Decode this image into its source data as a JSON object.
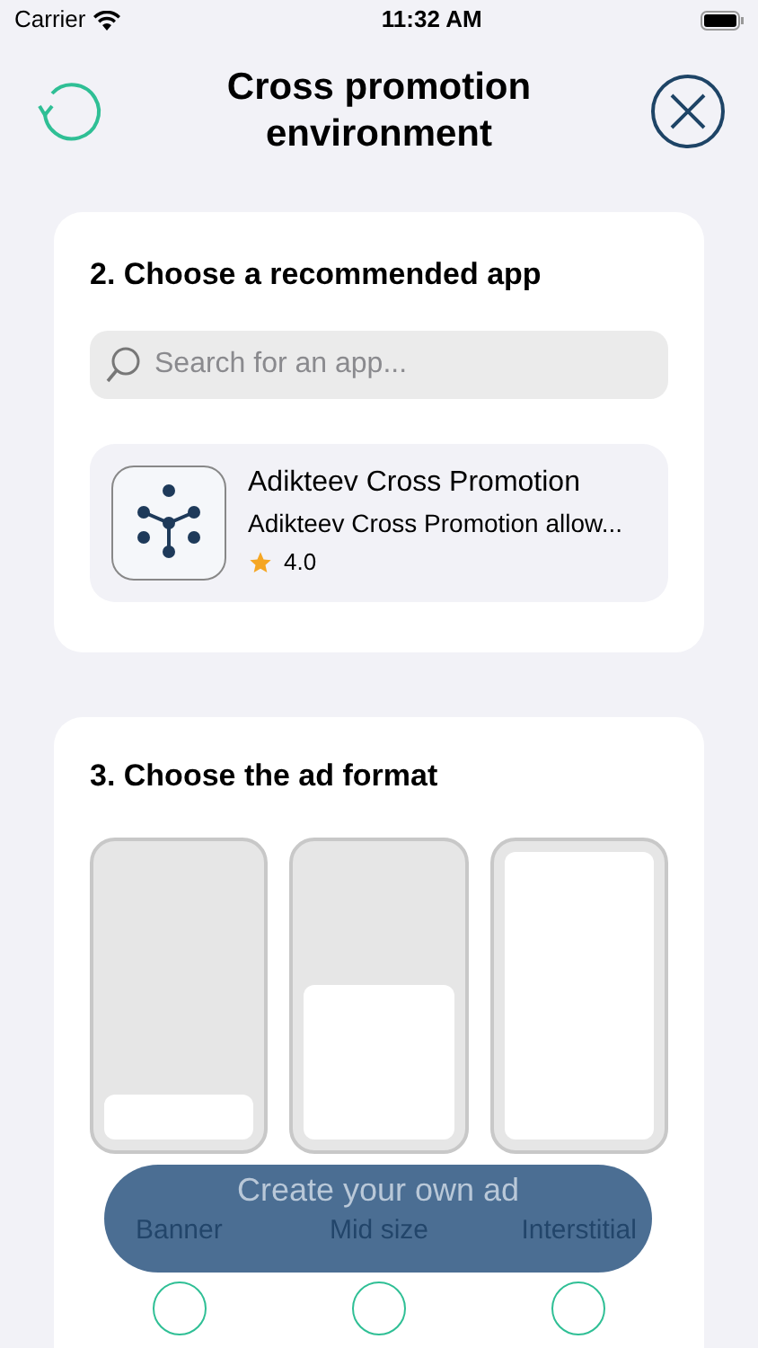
{
  "status_bar": {
    "carrier": "Carrier",
    "time": "11:32 AM"
  },
  "header": {
    "title": "Cross promotion environment"
  },
  "app_section": {
    "title": "2. Choose a recommended app",
    "search": {
      "placeholder": "Search for an app..."
    },
    "apps": [
      {
        "name": "Adikteev Cross Promotion",
        "description": "Adikteev Cross Promotion allow...",
        "rating": "4.0",
        "selected": false
      }
    ]
  },
  "format_section": {
    "title": "3. Choose the ad format",
    "formats": [
      {
        "kind": "banner",
        "label": "Banner",
        "selected": false
      },
      {
        "kind": "mid",
        "label": "Mid size",
        "selected": false
      },
      {
        "kind": "interstitial",
        "label": "Interstitial",
        "selected": false
      }
    ]
  },
  "create_button": {
    "label": "Create your own ad"
  }
}
